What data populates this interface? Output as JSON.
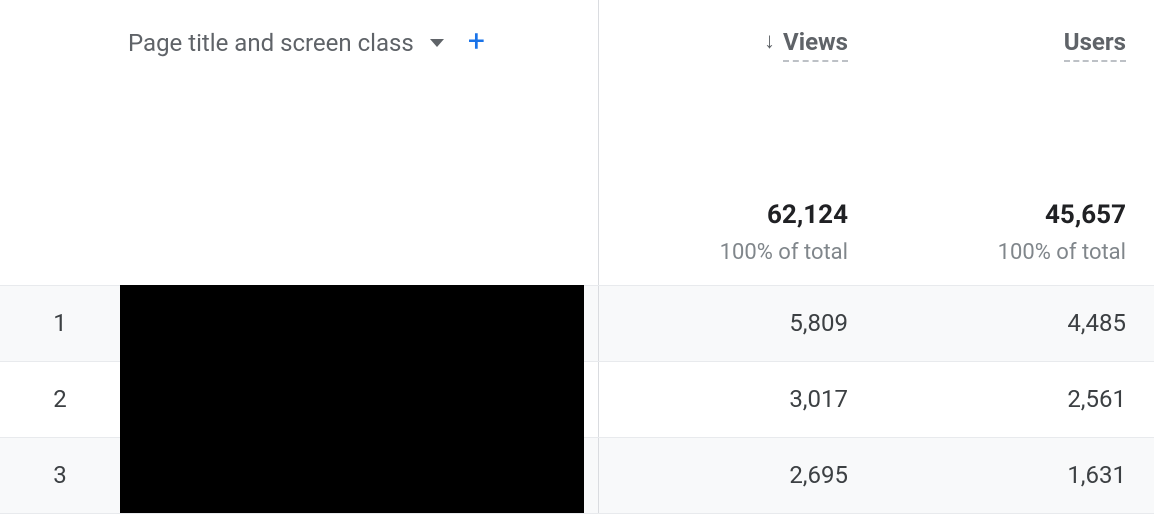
{
  "header": {
    "dimension_label": "Page title and screen class",
    "metrics": [
      {
        "label": "Views",
        "sorted": true
      },
      {
        "label": "Users",
        "sorted": false
      }
    ]
  },
  "totals": {
    "views": {
      "value": "62,124",
      "subtext": "100% of total"
    },
    "users": {
      "value": "45,657",
      "subtext": "100% of total"
    }
  },
  "rows": [
    {
      "index": "1",
      "views": "5,809",
      "users": "4,485"
    },
    {
      "index": "2",
      "views": "3,017",
      "users": "2,561"
    },
    {
      "index": "3",
      "views": "2,695",
      "users": "1,631"
    }
  ]
}
